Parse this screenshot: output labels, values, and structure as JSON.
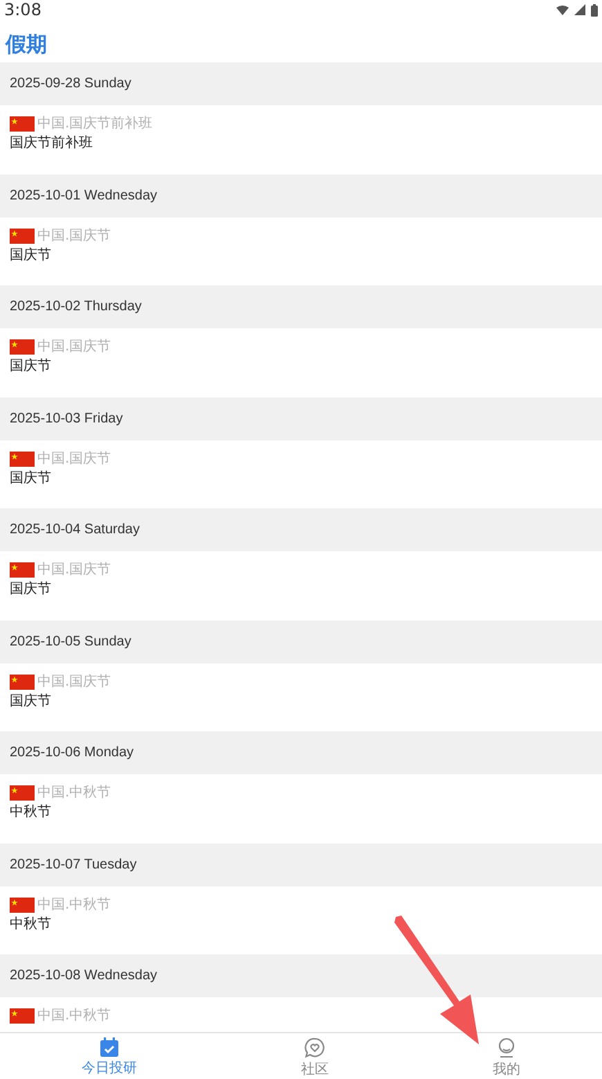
{
  "status_bar": {
    "time": "3:08"
  },
  "title": "假期",
  "days": [
    {
      "date": "2025-09-28 Sunday",
      "region": "中国.国庆节前补班",
      "name": "国庆节前补班"
    },
    {
      "date": "2025-10-01 Wednesday",
      "region": "中国.国庆节",
      "name": "国庆节"
    },
    {
      "date": "2025-10-02 Thursday",
      "region": "中国.国庆节",
      "name": "国庆节"
    },
    {
      "date": "2025-10-03 Friday",
      "region": "中国.国庆节",
      "name": "国庆节"
    },
    {
      "date": "2025-10-04 Saturday",
      "region": "中国.国庆节",
      "name": "国庆节"
    },
    {
      "date": "2025-10-05 Sunday",
      "region": "中国.国庆节",
      "name": "国庆节"
    },
    {
      "date": "2025-10-06 Monday",
      "region": "中国.中秋节",
      "name": "中秋节"
    },
    {
      "date": "2025-10-07 Tuesday",
      "region": "中国.中秋节",
      "name": "中秋节"
    },
    {
      "date": "2025-10-08 Wednesday",
      "region": "中国.中秋节"
    }
  ],
  "tabs": [
    {
      "kind": "calendar",
      "label": "今日投研",
      "selected": true
    },
    {
      "kind": "community",
      "label": "社区",
      "selected": false
    },
    {
      "kind": "profile",
      "label": "我的",
      "selected": false
    }
  ]
}
